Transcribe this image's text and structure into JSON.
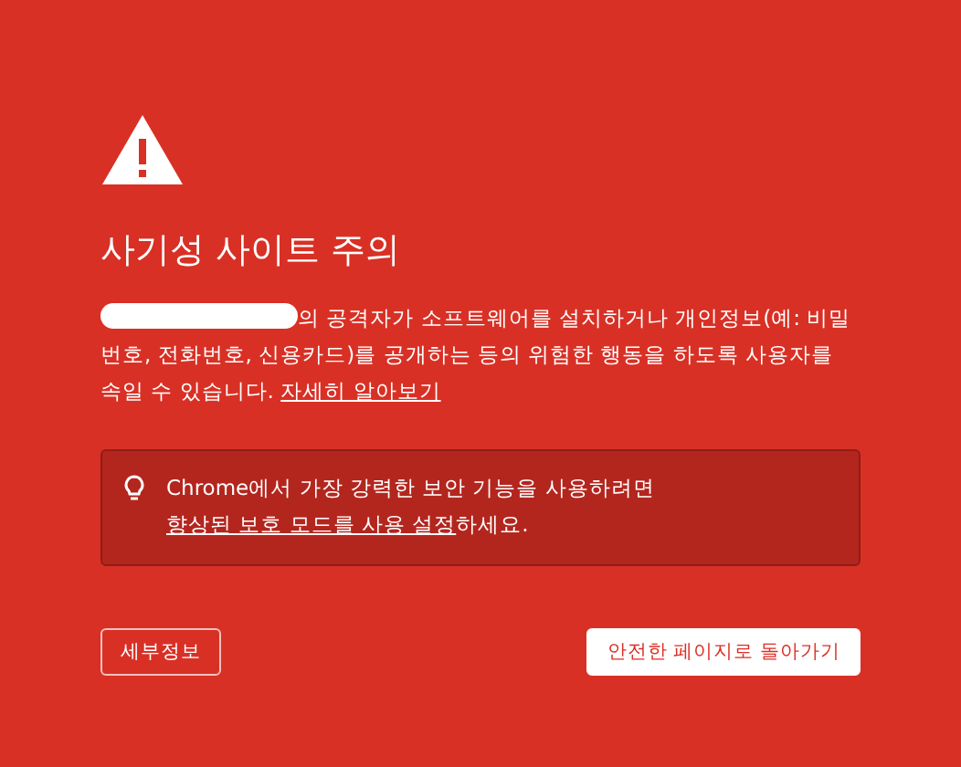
{
  "title": "사기성 사이트 주의",
  "description": {
    "redacted": true,
    "text": "의 공격자가 소프트웨어를 설치하거나 개인정보(예: 비밀번호, 전화번호, 신용카드)를 공개하는 등의 위험한 행동을 하도록 사용자를 속일 수 있습니다. ",
    "link": "자세히 알아보기"
  },
  "tip": {
    "text": "Chrome에서 가장 강력한 보안 기능을 사용하려면 ",
    "link": "향상된 보호 모드를 사용 설정",
    "text_after": "하세요."
  },
  "buttons": [
    {
      "label": "세부정보",
      "kind": "outline"
    },
    {
      "label": "안전한 페이지로 돌아가기",
      "kind": "primary"
    }
  ]
}
